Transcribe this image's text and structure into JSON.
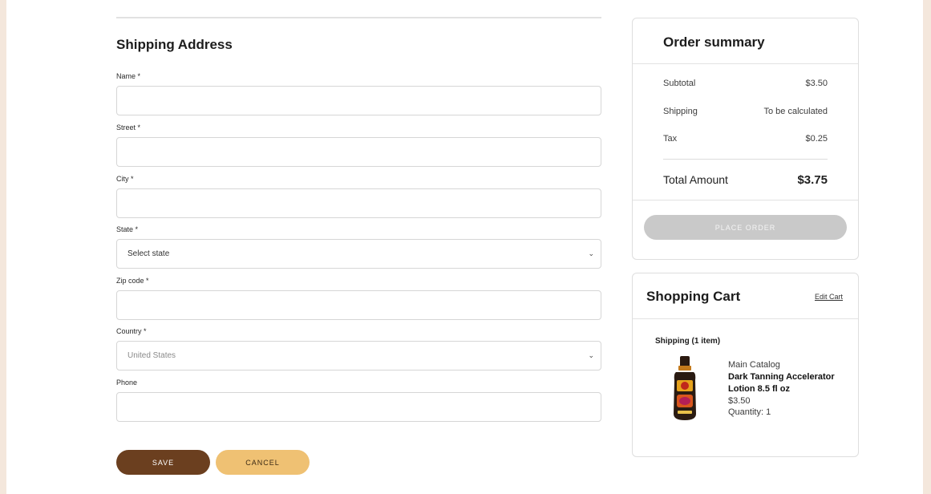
{
  "form": {
    "title": "Shipping Address",
    "fields": {
      "name": {
        "label": "Name *",
        "value": ""
      },
      "street": {
        "label": "Street *",
        "value": ""
      },
      "city": {
        "label": "City *",
        "value": ""
      },
      "state": {
        "label": "State *",
        "selected": "Select state"
      },
      "zip": {
        "label": "Zip code *",
        "value": ""
      },
      "country": {
        "label": "Country *",
        "selected": "United States"
      },
      "phone": {
        "label": "Phone",
        "value": ""
      }
    },
    "save_label": "SAVE",
    "cancel_label": "CANCEL"
  },
  "summary": {
    "title": "Order summary",
    "rows": [
      {
        "label": "Subtotal",
        "value": "$3.50"
      },
      {
        "label": "Shipping",
        "value": "To be calculated"
      },
      {
        "label": "Tax",
        "value": "$0.25"
      }
    ],
    "total_label": "Total Amount",
    "total_value": "$3.75",
    "place_order_label": "PLACE ORDER"
  },
  "cart": {
    "title": "Shopping Cart",
    "edit_label": "Edit Cart",
    "shipping_heading": "Shipping (1 item)",
    "item": {
      "catalog": "Main Catalog",
      "name": "Dark Tanning Accelerator Lotion 8.5 fl oz",
      "price": "$3.50",
      "quantity": "Quantity:  1"
    }
  },
  "colors": {
    "save_button": "#6b3f1f",
    "cancel_button": "#efc173",
    "place_order_disabled": "#c9c9c9",
    "background": "#f4e7dc"
  }
}
